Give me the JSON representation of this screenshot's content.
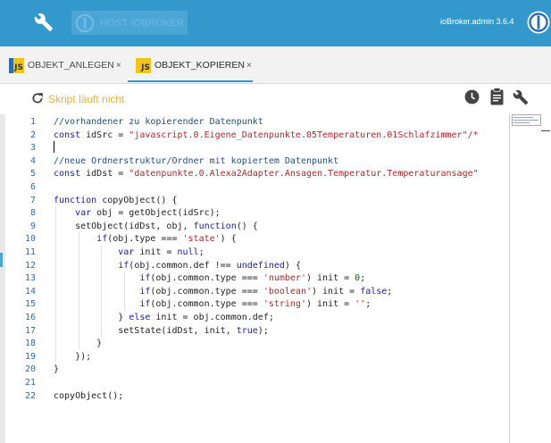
{
  "topbar": {
    "host_button_label": "HOST IOBROKER",
    "admin_version": "ioBroker.admin 3.6.4",
    "accent_color": "#3399cc"
  },
  "tabs": [
    {
      "label": "OBJEKT_ANLEGEN",
      "badge": "JS",
      "close": "×",
      "active": false
    },
    {
      "label": "OBJEKT_KOPIEREN",
      "badge": "JS",
      "close": "×",
      "active": true
    }
  ],
  "toolbar": {
    "status": "Skript läuft nicht",
    "status_color": "#e6b23a",
    "icons": [
      "refresh-icon",
      "clock-icon",
      "clipboard-icon",
      "wrench-icon"
    ]
  },
  "editor": {
    "lines": [
      {
        "n": "1",
        "tokens": [
          [
            "t-comment",
            "//vorhandener zu kopierender Datenpunkt"
          ]
        ]
      },
      {
        "n": "2",
        "tokens": [
          [
            "t-kw",
            "const"
          ],
          [
            "t-plain",
            " idSrc = "
          ],
          [
            "t-str",
            "\"javascript.0.Eigene_Datenpunkte.05Temperaturen.01Schlafzimmer\"/*"
          ]
        ]
      },
      {
        "n": "3",
        "tokens": []
      },
      {
        "n": "4",
        "tokens": [
          [
            "t-comment",
            "//neue Ordnerstruktur/Ordner mit kopiertem Datenpunkt"
          ]
        ]
      },
      {
        "n": "5",
        "tokens": [
          [
            "t-kw",
            "const"
          ],
          [
            "t-plain",
            " idDst = "
          ],
          [
            "t-str",
            "\"datenpunkte.0.Alexa2Adapter.Ansagen.Temperatur.Temperaturansage\""
          ]
        ]
      },
      {
        "n": "6",
        "tokens": []
      },
      {
        "n": "7",
        "tokens": [
          [
            "t-kw",
            "function"
          ],
          [
            "t-plain",
            " copyObject() {"
          ]
        ]
      },
      {
        "n": "8",
        "tokens": [
          [
            "t-plain",
            "    "
          ],
          [
            "t-kw",
            "var"
          ],
          [
            "t-plain",
            " obj = getObject(idSrc);"
          ]
        ]
      },
      {
        "n": "9",
        "tokens": [
          [
            "t-plain",
            "    setObject(idDst, obj, "
          ],
          [
            "t-kw",
            "function"
          ],
          [
            "t-plain",
            "() {"
          ]
        ]
      },
      {
        "n": "10",
        "tokens": [
          [
            "t-plain",
            "        "
          ],
          [
            "t-kw",
            "if"
          ],
          [
            "t-plain",
            "(obj.type === "
          ],
          [
            "t-str",
            "'state'"
          ],
          [
            "t-plain",
            ") {"
          ]
        ]
      },
      {
        "n": "11",
        "tokens": [
          [
            "t-plain",
            "            "
          ],
          [
            "t-kw",
            "var"
          ],
          [
            "t-plain",
            " init = "
          ],
          [
            "t-kw",
            "null"
          ],
          [
            "t-plain",
            ";"
          ]
        ]
      },
      {
        "n": "12",
        "tokens": [
          [
            "t-plain",
            "            "
          ],
          [
            "t-kw",
            "if"
          ],
          [
            "t-plain",
            "(obj.common.def !== "
          ],
          [
            "t-kw",
            "undefined"
          ],
          [
            "t-plain",
            ") {"
          ]
        ]
      },
      {
        "n": "13",
        "tokens": [
          [
            "t-plain",
            "                "
          ],
          [
            "t-kw",
            "if"
          ],
          [
            "t-plain",
            "(obj.common.type === "
          ],
          [
            "t-str",
            "'number'"
          ],
          [
            "t-plain",
            ") init = "
          ],
          [
            "t-num",
            "0"
          ],
          [
            "t-plain",
            ";"
          ]
        ]
      },
      {
        "n": "14",
        "tokens": [
          [
            "t-plain",
            "                "
          ],
          [
            "t-kw",
            "if"
          ],
          [
            "t-plain",
            "(obj.common.type === "
          ],
          [
            "t-str",
            "'boolean'"
          ],
          [
            "t-plain",
            ") init = "
          ],
          [
            "t-kw",
            "false"
          ],
          [
            "t-plain",
            ";"
          ]
        ]
      },
      {
        "n": "15",
        "tokens": [
          [
            "t-plain",
            "                "
          ],
          [
            "t-kw",
            "if"
          ],
          [
            "t-plain",
            "(obj.common.type === "
          ],
          [
            "t-str",
            "'string'"
          ],
          [
            "t-plain",
            ") init = "
          ],
          [
            "t-str",
            "''"
          ],
          [
            "t-plain",
            ";"
          ]
        ]
      },
      {
        "n": "16",
        "tokens": [
          [
            "t-plain",
            "            } "
          ],
          [
            "t-kw",
            "else"
          ],
          [
            "t-plain",
            " init = obj.common.def;"
          ]
        ]
      },
      {
        "n": "17",
        "tokens": [
          [
            "t-plain",
            "            setState(idDst, init, "
          ],
          [
            "t-kw",
            "true"
          ],
          [
            "t-plain",
            ");"
          ]
        ]
      },
      {
        "n": "18",
        "tokens": [
          [
            "t-plain",
            "        }"
          ]
        ]
      },
      {
        "n": "19",
        "tokens": [
          [
            "t-plain",
            "    });"
          ]
        ]
      },
      {
        "n": "20",
        "tokens": [
          [
            "t-plain",
            "}"
          ]
        ]
      },
      {
        "n": "21",
        "tokens": []
      },
      {
        "n": "22",
        "tokens": [
          [
            "t-plain",
            "copyObject();"
          ]
        ]
      }
    ]
  }
}
